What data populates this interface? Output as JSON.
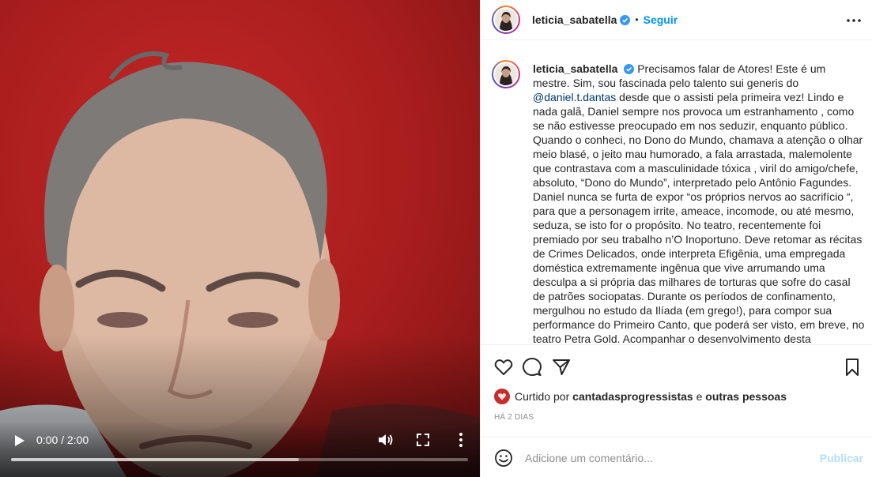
{
  "video": {
    "time_display": "0:00 / 2:00",
    "played_fraction": 0.0,
    "buffered_fraction": 0.63,
    "background_color": "#b01f1f"
  },
  "header": {
    "username": "leticia_sabatella",
    "separator": "•",
    "follow_label": "Seguir"
  },
  "caption": {
    "username": "leticia_sabatella",
    "text_before_mention": "Precisamos falar de Atores! Este é um mestre. Sim, sou fascinada pelo talento sui generis do ",
    "mention": "@daniel.t.dantas",
    "text_after_mention": " desde que o assisti pela primeira vez! Lindo e nada galã, Daniel sempre nos provoca um estranhamento , como se não estivesse preocupado em nos seduzir, enquanto público. Quando o conheci, no Dono do Mundo, chamava a atenção o olhar meio blasé, o jeito mau humorado, a fala arrastada, malemolente que contrastava com a masculinidade tóxica , viril do amigo/chefe, absoluto, “Dono do Mundo”, interpretado pelo Antônio Fagundes. Daniel nunca se furta de expor “os próprios nervos ao sacrifício “, para que a personagem irrite, ameace, incomode, ou até mesmo, seduza, se isto for o propósito. No teatro, recentemente foi premiado por seu trabalho n’O Inoportuno. Deve retomar as récitas de Crimes Delicados, onde interpreta Efigênia, uma empregada doméstica extremamente ingênua que vive arrumando uma desculpa a si própria das milhares de torturas que sofre do casal de patrões sociopatas. Durante os períodos de confinamento, mergulhou no estudo da Ilíada (em grego!), para compor sua performance do Primeiro Canto, que poderá ser visto, em breve, no teatro Petra Gold. Acompanhar o desenvolvimento desta personagem com"
  },
  "likes": {
    "prefix": "Curtido por",
    "user": "cantadasprogressistas",
    "connector": "e",
    "others": "outras pessoas"
  },
  "timestamp": "HÁ 2 DIAS",
  "comment": {
    "placeholder": "Adicione um comentário...",
    "publish_label": "Publicar"
  },
  "colors": {
    "accent": "#0095f6",
    "publish_disabled": "#b2dffc",
    "verified": "#3897f0"
  },
  "icons": [
    "play-icon",
    "volume-icon",
    "fullscreen-icon",
    "more-vertical-icon",
    "verified-badge-icon",
    "more-horizontal-icon",
    "heart-icon",
    "comment-icon",
    "share-icon",
    "bookmark-icon",
    "emoji-icon"
  ]
}
